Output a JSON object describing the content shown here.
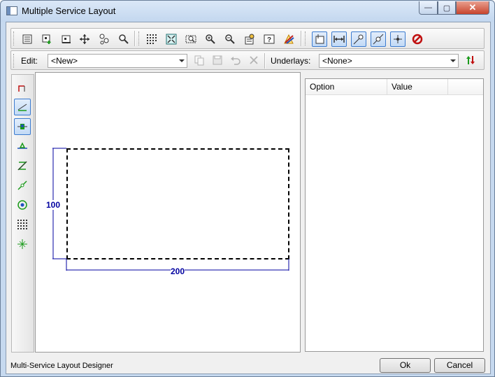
{
  "window": {
    "title": "Multiple Service Layout",
    "minimize_label": "—",
    "maximize_label": "▢",
    "close_label": "✕"
  },
  "toolbar_icons": [
    "properties-icon",
    "add-view-icon",
    "view-icon",
    "pan-icon",
    "orbit-icon",
    "zoom-icon",
    "grid-icon",
    "zoom-extents-icon",
    "zoom-window-icon",
    "zoom-in-icon",
    "zoom-out-icon",
    "settings-icon",
    "help-icon",
    "render-icon",
    "snap-layout-icon",
    "snap-dimension-icon",
    "snap-endpoint-icon",
    "snap-midpoint-icon",
    "snap-point-icon",
    "no-snap-icon"
  ],
  "edit": {
    "label": "Edit:",
    "value": "<New>"
  },
  "underlays": {
    "label": "Underlays:",
    "value": "<None>"
  },
  "sidebar_tools": [
    "corner-tool-icon",
    "line-tool-icon",
    "service-point-icon",
    "tap-tool-icon",
    "no-route-icon",
    "route-icon",
    "target-icon",
    "grid-icon",
    "crosshair-icon"
  ],
  "canvas": {
    "width_label": "200",
    "height_label": "100",
    "accent_color": "#0000a0"
  },
  "properties": {
    "columns": [
      "Option",
      "Value"
    ]
  },
  "statusbar": {
    "text": "Multi-Service Layout Designer",
    "ok_label": "Ok",
    "cancel_label": "Cancel"
  }
}
